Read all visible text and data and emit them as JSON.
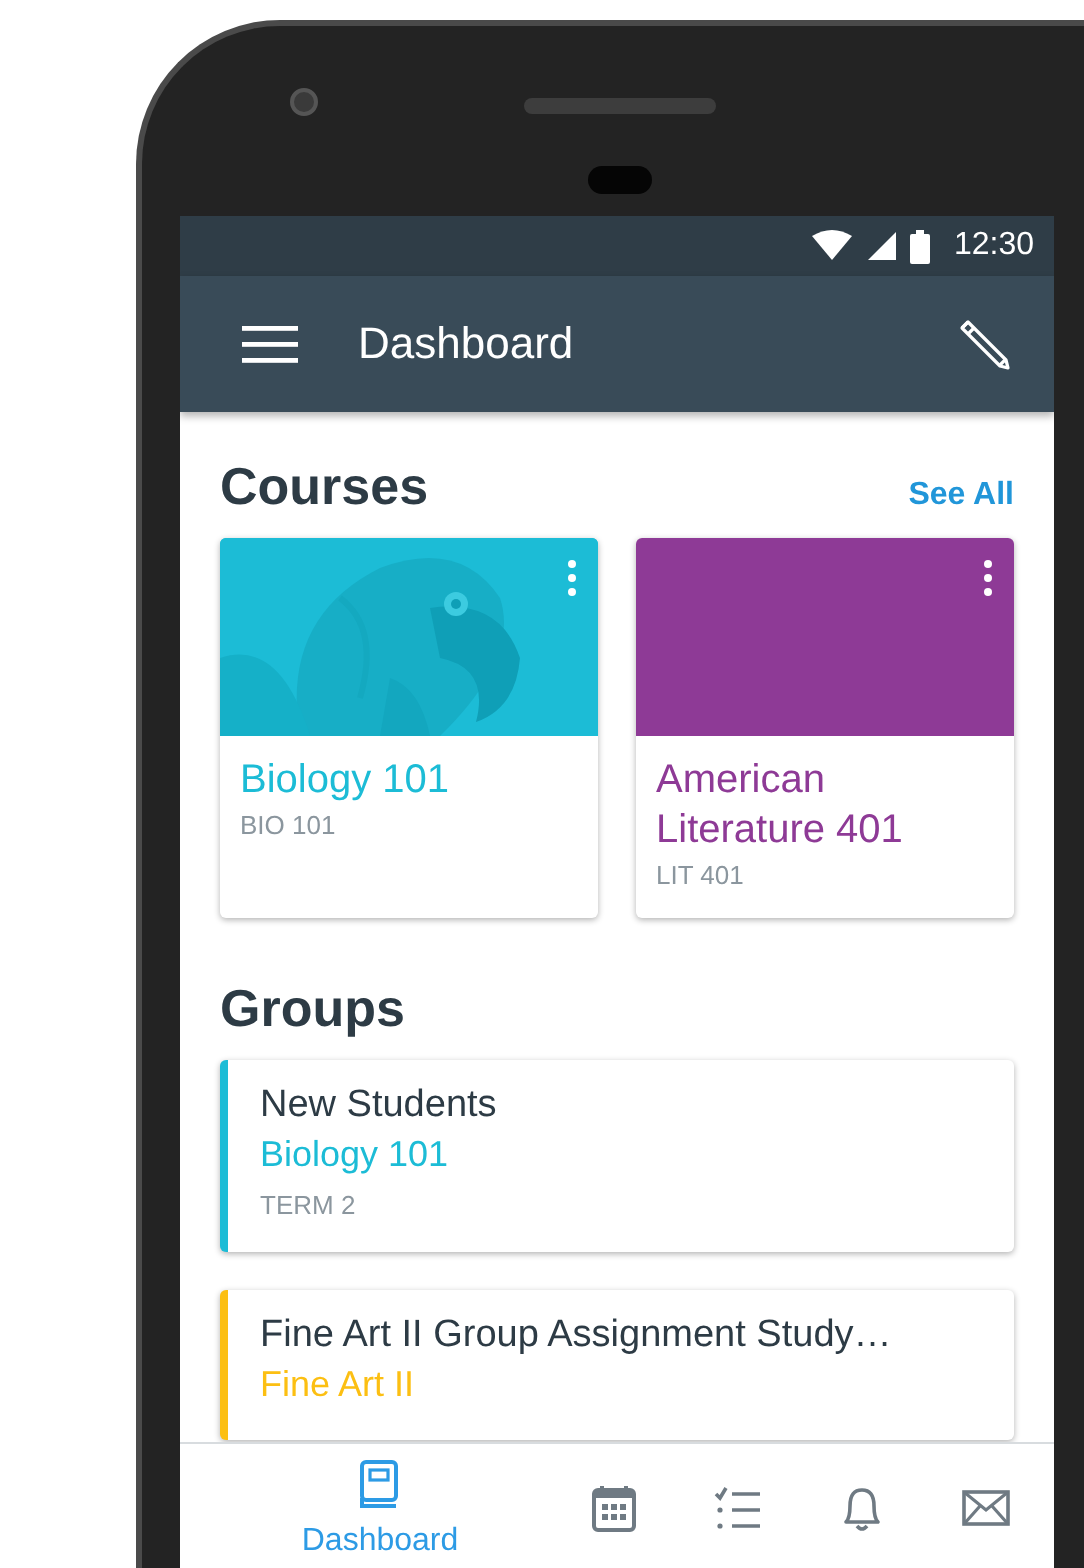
{
  "status_bar": {
    "time": "12:30"
  },
  "app_bar": {
    "title": "Dashboard"
  },
  "courses": {
    "heading": "Courses",
    "see_all": "See All",
    "items": [
      {
        "kind": "picture",
        "title": "Biology 101",
        "code": "BIO 101",
        "color": "#1cbcd6"
      },
      {
        "kind": "solid",
        "title": "American Literature 401",
        "code": "LIT 401",
        "color": "#8e3a96"
      }
    ]
  },
  "groups": {
    "heading": "Groups",
    "items": [
      {
        "name": "New Students",
        "course": "Biology 101",
        "term": "TERM 2",
        "color": "#1cbcd6"
      },
      {
        "name": "Fine Art II Group Assignment Study…",
        "course": "Fine Art II",
        "color": "#fcbf12"
      }
    ]
  },
  "tab_bar": [
    {
      "kind": "dashboard",
      "label": "Dashboard",
      "selected": true
    },
    {
      "kind": "calendar",
      "selected": false
    },
    {
      "kind": "todo",
      "selected": false
    },
    {
      "kind": "notifications",
      "selected": false
    },
    {
      "kind": "inbox",
      "selected": false
    }
  ]
}
